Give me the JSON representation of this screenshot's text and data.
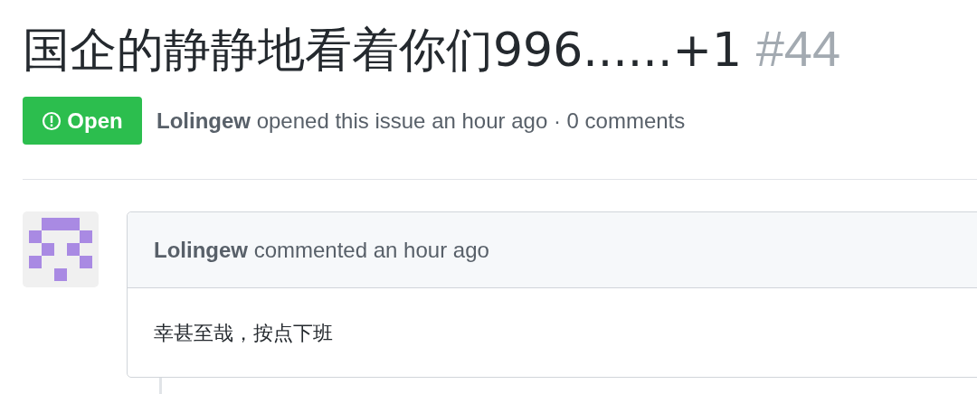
{
  "issue": {
    "title": "国企的静静地看着你们996......+1",
    "number": "#44"
  },
  "status": {
    "kind": "open",
    "label": "Open"
  },
  "meta": {
    "author": "Lolingew",
    "text": "opened this issue an hour ago · 0 comments"
  },
  "comment": {
    "author": "Lolingew",
    "action": "commented an hour ago",
    "body": "幸甚至哉，按点下班"
  }
}
